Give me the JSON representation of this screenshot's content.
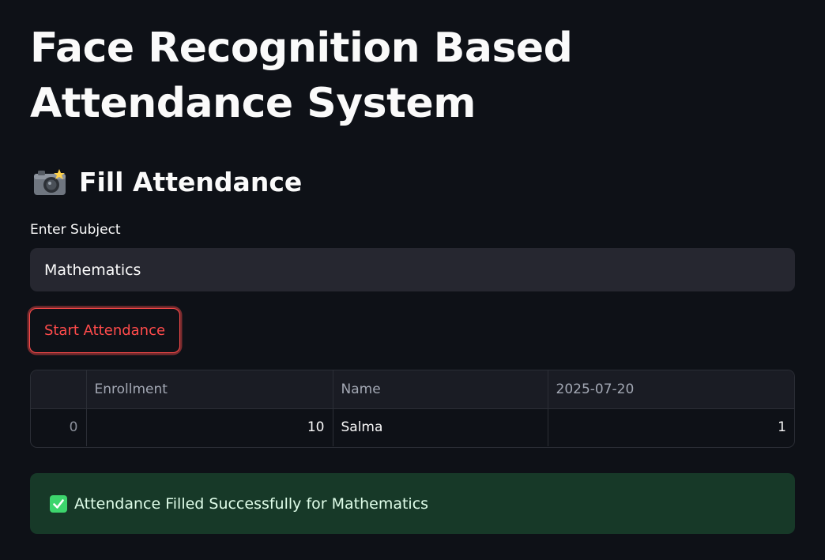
{
  "page": {
    "title": "Face Recognition Based Attendance System"
  },
  "section": {
    "icon": "camera-icon",
    "heading": "Fill Attendance"
  },
  "subject_input": {
    "label": "Enter Subject",
    "value": "Mathematics"
  },
  "actions": {
    "start_label": "Start Attendance"
  },
  "table": {
    "columns": [
      "",
      "Enrollment",
      "Name",
      "2025-07-20"
    ],
    "rows": [
      {
        "index": "0",
        "enrollment": "10",
        "name": "Salma",
        "date_value": "1"
      }
    ]
  },
  "alert": {
    "icon": "check-mark-icon",
    "message": "Attendance Filled Successfully for Mathematics"
  },
  "colors": {
    "background": "#0e1117",
    "primary": "#ff4b4b",
    "success_bg": "#173928",
    "input_bg": "#262730"
  }
}
